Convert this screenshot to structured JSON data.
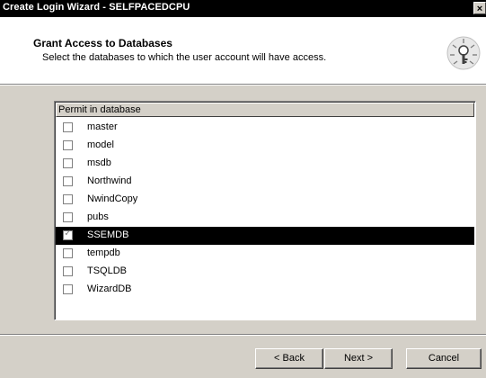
{
  "window": {
    "title": "Create Login Wizard - SELFPACEDCPU",
    "close_glyph": "×"
  },
  "header": {
    "title": "Grant Access to Databases",
    "subtitle": "Select the databases to which the user account will have access.",
    "icon": "key-wizard-icon"
  },
  "list": {
    "column_header": "Permit in database",
    "items": [
      {
        "label": "master",
        "checked": false,
        "selected": false
      },
      {
        "label": "model",
        "checked": false,
        "selected": false
      },
      {
        "label": "msdb",
        "checked": false,
        "selected": false
      },
      {
        "label": "Northwind",
        "checked": false,
        "selected": false
      },
      {
        "label": "NwindCopy",
        "checked": false,
        "selected": false
      },
      {
        "label": "pubs",
        "checked": false,
        "selected": false
      },
      {
        "label": "SSEMDB",
        "checked": true,
        "selected": true
      },
      {
        "label": "tempdb",
        "checked": false,
        "selected": false
      },
      {
        "label": "TSQLDB",
        "checked": false,
        "selected": false
      },
      {
        "label": "WizardDB",
        "checked": false,
        "selected": false
      }
    ]
  },
  "buttons": {
    "back": "< Back",
    "next": "Next >",
    "cancel": "Cancel"
  },
  "colors": {
    "dialog_bg": "#d4d0c8",
    "titlebar_bg": "#000000",
    "selection_bg": "#000000"
  }
}
